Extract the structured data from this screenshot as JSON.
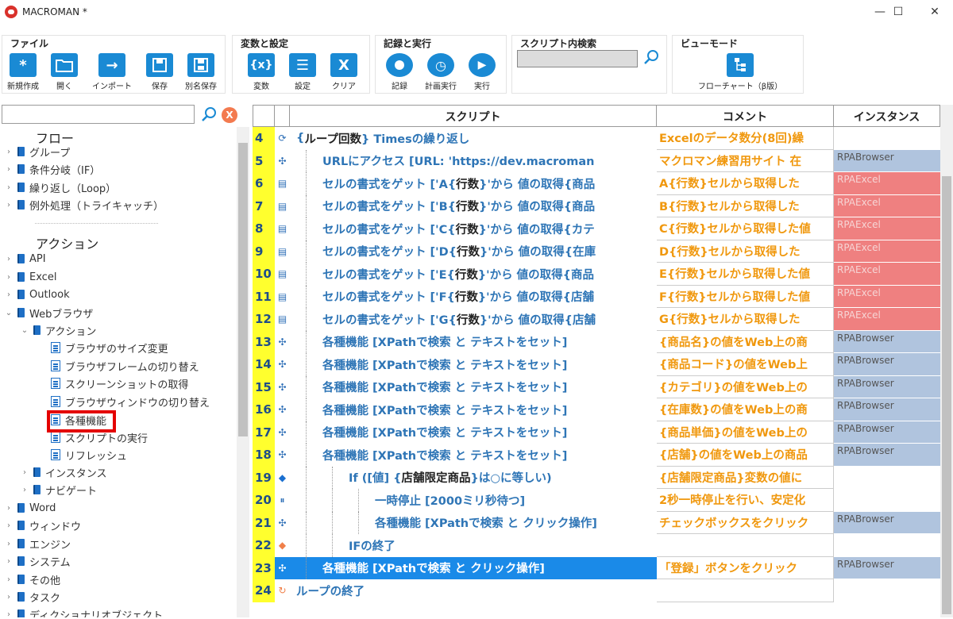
{
  "window": {
    "title": "MACROMAN *",
    "minimize": "—",
    "maximize": "☐",
    "close": "✕"
  },
  "ribbon": {
    "file": {
      "title": "ファイル",
      "buttons": [
        "新規作成",
        "開く",
        "インポート",
        "保存",
        "別名保存"
      ]
    },
    "vars": {
      "title": "変数と設定",
      "buttons": [
        "変数",
        "設定",
        "クリア"
      ]
    },
    "run": {
      "title": "記録と実行",
      "buttons": [
        "記録",
        "計画実行",
        "実行"
      ]
    },
    "search": {
      "title": "スクリプト内検索"
    },
    "view": {
      "title": "ビューモード",
      "button": "フローチャート（β版）"
    }
  },
  "left_panel": {
    "clear_label": "X",
    "flow_head": "フロー",
    "flow_items": [
      "グループ",
      "条件分岐（IF）",
      "繰り返し（Loop）",
      "例外処理（トライキャッチ）"
    ],
    "action_head": "アクション",
    "action_items": [
      "API",
      "Excel",
      "Outlook",
      "Webブラウザ"
    ],
    "web_sub": "アクション",
    "web_actions": [
      "ブラウザのサイズ変更",
      "ブラウザフレームの切り替え",
      "スクリーンショットの取得",
      "ブラウザウィンドウの切り替え",
      "各種機能",
      "スクリプトの実行",
      "リフレッシュ"
    ],
    "web_more": [
      "インスタンス",
      "ナビゲート"
    ],
    "bottom_items": [
      "Word",
      "ウィンドウ",
      "エンジン",
      "システム",
      "その他",
      "タスク",
      "ディクショナリオブジェクト"
    ]
  },
  "grid": {
    "headers": {
      "script": "スクリプト",
      "comment": "コメント",
      "instance": "インスタンス"
    },
    "rows": [
      {
        "n": "4",
        "icon": "loop",
        "indent": 0,
        "pre": "{",
        "blk": "ループ回数",
        "post": "} Timesの繰り返し",
        "comment": "Excelのデータ数分(8回)繰",
        "inst": "",
        "it": ""
      },
      {
        "n": "5",
        "icon": "gear",
        "indent": 1,
        "pre": "URLにアクセス [URL: 'https://dev.macroman",
        "blk": "",
        "post": "",
        "comment": "マクロマン練習用サイト 在",
        "inst": "RPABrowser",
        "it": "b"
      },
      {
        "n": "6",
        "icon": "doc",
        "indent": 1,
        "pre": "セルの書式をゲット ['A{",
        "blk": "行数",
        "post": "}'から 値の取得{商品",
        "comment": "A{行数}セルから取得した",
        "inst": "RPAExcel",
        "it": "e"
      },
      {
        "n": "7",
        "icon": "doc",
        "indent": 1,
        "pre": "セルの書式をゲット ['B{",
        "blk": "行数",
        "post": "}'から 値の取得{商品",
        "comment": "B{行数}セルから取得した",
        "inst": "RPAExcel",
        "it": "e"
      },
      {
        "n": "8",
        "icon": "doc",
        "indent": 1,
        "pre": "セルの書式をゲット ['C{",
        "blk": "行数",
        "post": "}'から 値の取得{カテ",
        "comment": "C{行数}セルから取得した値",
        "inst": "RPAExcel",
        "it": "e"
      },
      {
        "n": "9",
        "icon": "doc",
        "indent": 1,
        "pre": "セルの書式をゲット ['D{",
        "blk": "行数",
        "post": "}'から 値の取得{在庫",
        "comment": "D{行数}セルから取得した",
        "inst": "RPAExcel",
        "it": "e"
      },
      {
        "n": "10",
        "icon": "doc",
        "indent": 1,
        "pre": "セルの書式をゲット ['E{",
        "blk": "行数",
        "post": "}'から 値の取得{商品",
        "comment": "E{行数}セルから取得した値",
        "inst": "RPAExcel",
        "it": "e"
      },
      {
        "n": "11",
        "icon": "doc",
        "indent": 1,
        "pre": "セルの書式をゲット ['F{",
        "blk": "行数",
        "post": "}'から 値の取得{店舗",
        "comment": "F{行数}セルから取得した値",
        "inst": "RPAExcel",
        "it": "e"
      },
      {
        "n": "12",
        "icon": "doc",
        "indent": 1,
        "pre": "セルの書式をゲット ['G{",
        "blk": "行数",
        "post": "}'から 値の取得{店舗",
        "comment": "G{行数}セルから取得した",
        "inst": "RPAExcel",
        "it": "e"
      },
      {
        "n": "13",
        "icon": "gear",
        "indent": 1,
        "pre": "各種機能 [XPathで検索 と テキストをセット]",
        "blk": "",
        "post": "",
        "comment": "{商品名}の値をWeb上の商",
        "inst": "RPABrowser",
        "it": "b"
      },
      {
        "n": "14",
        "icon": "gear",
        "indent": 1,
        "pre": "各種機能 [XPathで検索 と テキストをセット]",
        "blk": "",
        "post": "",
        "comment": "{商品コード}の値をWeb上",
        "inst": "RPABrowser",
        "it": "b"
      },
      {
        "n": "15",
        "icon": "gear",
        "indent": 1,
        "pre": "各種機能 [XPathで検索 と テキストをセット]",
        "blk": "",
        "post": "",
        "comment": "{カテゴリ}の値をWeb上の",
        "inst": "RPABrowser",
        "it": "b"
      },
      {
        "n": "16",
        "icon": "gear",
        "indent": 1,
        "pre": "各種機能 [XPathで検索 と テキストをセット]",
        "blk": "",
        "post": "",
        "comment": "{在庫数}の値をWeb上の商",
        "inst": "RPABrowser",
        "it": "b"
      },
      {
        "n": "17",
        "icon": "gear",
        "indent": 1,
        "pre": "各種機能 [XPathで検索 と テキストをセット]",
        "blk": "",
        "post": "",
        "comment": "{商品単価}の値をWeb上の",
        "inst": "RPABrowser",
        "it": "b"
      },
      {
        "n": "18",
        "icon": "gear",
        "indent": 1,
        "pre": "各種機能 [XPathで検索 と テキストをセット]",
        "blk": "",
        "post": "",
        "comment": "{店舗}の値をWeb上の商品",
        "inst": "RPABrowser",
        "it": "b"
      },
      {
        "n": "19",
        "icon": "diamond-blue",
        "indent": 2,
        "pre": "If ([値] {",
        "blk": "店舗限定商品",
        "post": "}は○に等しい)",
        "comment": "{店舗限定商品}変数の値に",
        "inst": "",
        "it": ""
      },
      {
        "n": "20",
        "icon": "pause",
        "indent": 3,
        "pre": "一時停止 [2000ミリ秒待つ]",
        "blk": "",
        "post": "",
        "comment": "2秒一時停止を行い、安定化",
        "inst": "",
        "it": ""
      },
      {
        "n": "21",
        "icon": "gear",
        "indent": 3,
        "pre": "各種機能 [XPathで検索 と クリック操作]",
        "blk": "",
        "post": "",
        "comment": "チェックボックスをクリック",
        "inst": "RPABrowser",
        "it": "b"
      },
      {
        "n": "22",
        "icon": "diamond-orange",
        "indent": 2,
        "pre": "IFの終了",
        "blk": "",
        "post": "",
        "comment": "",
        "inst": "",
        "it": ""
      },
      {
        "n": "23",
        "icon": "gear",
        "indent": 1,
        "pre": "各種機能 [XPathで検索 と クリック操作]",
        "blk": "",
        "post": "",
        "comment": "「登録」ボタンをクリック",
        "inst": "RPABrowser",
        "it": "b",
        "selected": true
      },
      {
        "n": "24",
        "icon": "loop-end",
        "indent": 0,
        "pre": "ループの終了",
        "blk": "",
        "post": "",
        "comment": "",
        "inst": "",
        "it": ""
      }
    ]
  },
  "colors": {
    "accent": "#1a8ad4",
    "rownum": "#ffff2e",
    "script": "#2e75b6",
    "comment": "#f0980e",
    "inst_browser": "#b0c4de",
    "inst_excel": "#ef8080",
    "selected": "#1a8ae8"
  }
}
